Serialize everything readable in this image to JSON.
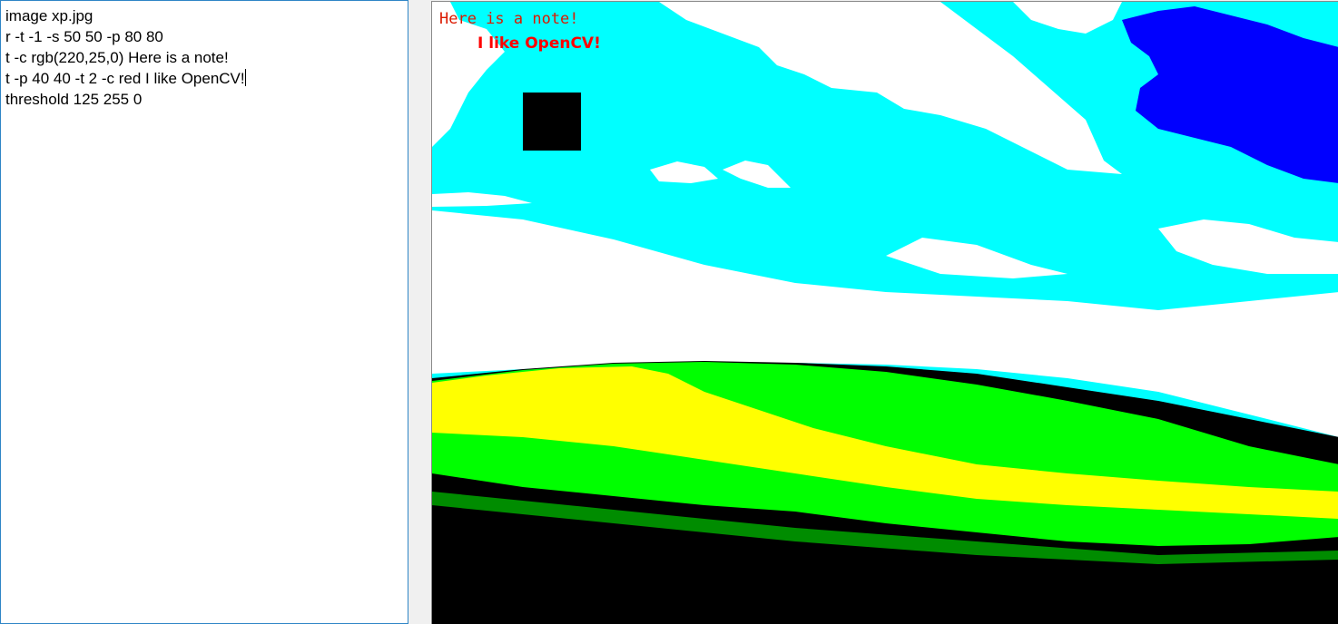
{
  "editor": {
    "lines": [
      "image xp.jpg",
      "r -t -1 -s 50 50 -p 80 80",
      "t -c rgb(220,25,0) Here is a note!",
      "t -p 40 40 -t 2 -c red I like OpenCV!",
      "threshold 125 255 0"
    ]
  },
  "output": {
    "note_text": "Here is a note!",
    "note_color": "#dc1900",
    "opencv_text": "I like OpenCV!",
    "opencv_color": "#ff0000",
    "palette": {
      "cyan": "#00ffff",
      "white": "#ffffff",
      "blue": "#0000ff",
      "yellow": "#ffff00",
      "green": "#00ff00",
      "black": "#000000"
    }
  }
}
